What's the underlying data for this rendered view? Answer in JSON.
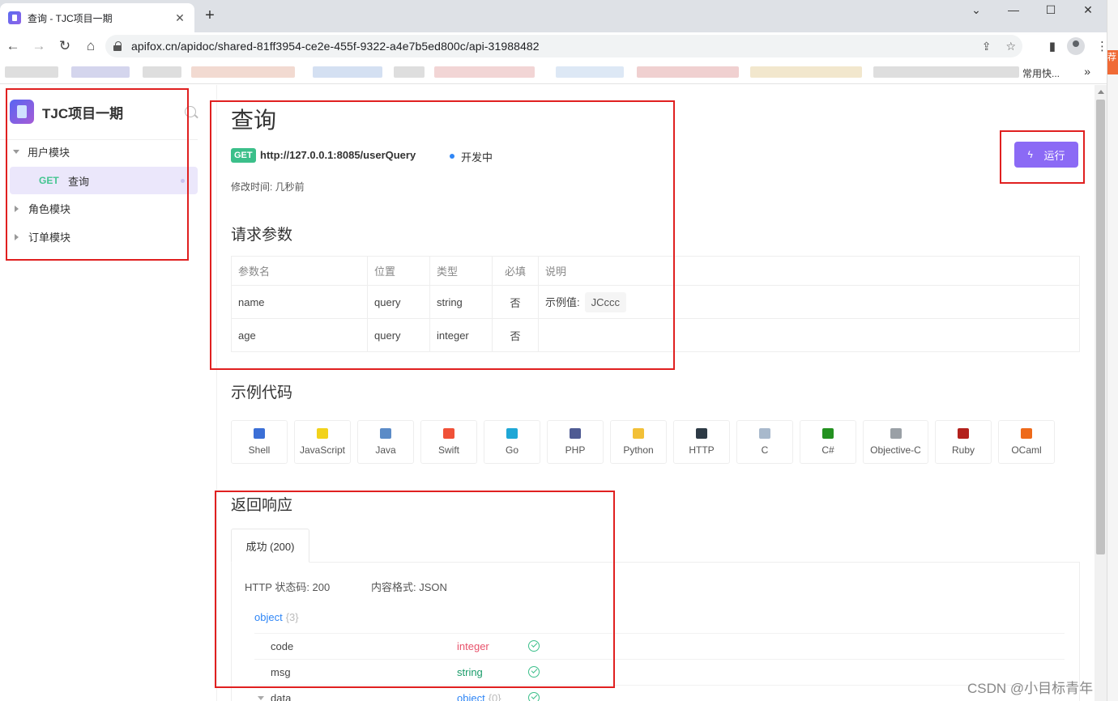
{
  "browser": {
    "tab_title": "查询 - TJC项目一期",
    "url": "apifox.cn/apidoc/shared-81ff3954-ce2e-455f-9322-a4e7b5ed800c/api-31988482",
    "bookmark_visible_text": "常用快...",
    "side_strip_text": "荐"
  },
  "sidebar": {
    "project_name": "TJC项目一期",
    "folders": [
      {
        "label": "用户模块",
        "expanded": true
      },
      {
        "label": "角色模块",
        "expanded": false
      },
      {
        "label": "订单模块",
        "expanded": false
      }
    ],
    "active_api": {
      "method": "GET",
      "name": "查询"
    }
  },
  "api": {
    "title": "查询",
    "method": "GET",
    "path": "http://127.0.0.1:8085/userQuery",
    "status": "开发中",
    "modified": "修改时间: 几秒前",
    "run_label": "运行"
  },
  "params": {
    "title": "请求参数",
    "headers": [
      "参数名",
      "位置",
      "类型",
      "必填",
      "说明"
    ],
    "rows": [
      {
        "name": "name",
        "location": "query",
        "type": "string",
        "required": "否",
        "desc_label": "示例值:",
        "example": "JCccc"
      },
      {
        "name": "age",
        "location": "query",
        "type": "integer",
        "required": "否",
        "desc_label": "",
        "example": ""
      }
    ]
  },
  "code": {
    "title": "示例代码",
    "langs": [
      {
        "label": "Shell",
        "color": "#3b6fd6"
      },
      {
        "label": "JavaScript",
        "color": "#f2d21b"
      },
      {
        "label": "Java",
        "color": "#5b8bc7"
      },
      {
        "label": "Swift",
        "color": "#f05138"
      },
      {
        "label": "Go",
        "color": "#1ea7d6"
      },
      {
        "label": "PHP",
        "color": "#4f5b93"
      },
      {
        "label": "Python",
        "color": "#f2c037"
      },
      {
        "label": "HTTP",
        "color": "#2d3a45"
      },
      {
        "label": "C",
        "color": "#a8b9cc"
      },
      {
        "label": "C#",
        "color": "#239120"
      },
      {
        "label": "Objective-C",
        "color": "#9aa0a6"
      },
      {
        "label": "Ruby",
        "color": "#b3211c"
      },
      {
        "label": "OCaml",
        "color": "#ee6a1a"
      }
    ]
  },
  "response": {
    "title": "返回响应",
    "tab_label": "成功 (200)",
    "status_code": "HTTP 状态码: 200",
    "content_type": "内容格式: JSON",
    "root_type": "object",
    "root_count": "{3}",
    "fields": [
      {
        "name": "code",
        "type": "integer",
        "type_color": "#e8526b"
      },
      {
        "name": "msg",
        "type": "string",
        "type_color": "#1a9c6a"
      },
      {
        "name": "data",
        "type": "object",
        "count": "{0}",
        "type_color": "#2f86f6"
      }
    ]
  },
  "watermark": "CSDN @小目标青年"
}
